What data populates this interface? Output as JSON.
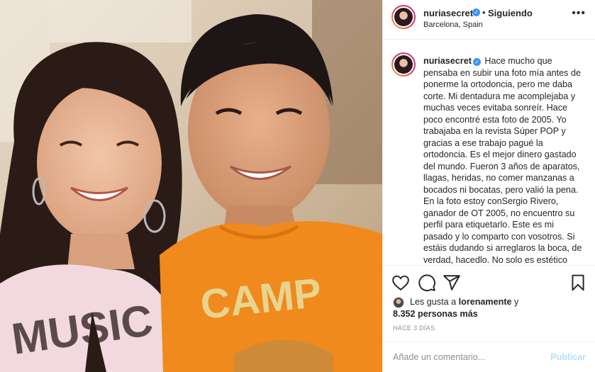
{
  "post": {
    "username": "nuriasecret",
    "follow_state": "Siguiendo",
    "separator": "•",
    "location": "Barcelona, Spain",
    "more_glyph": "•••",
    "verified_glyph": "✓"
  },
  "photo": {
    "shirt_left_text": "MUSIC",
    "shirt_right_text": "CAMP"
  },
  "caption": {
    "username": "nuriasecret",
    "text": "Hace mucho que pensaba en subir una foto mía antes de ponerme la ortodoncia, pero me daba corte. Mi dentadura me acomplejaba y muchas veces evitaba sonreír. Hace poco encontré esta foto de 2005. Yo trabajaba en la revista Súper POP y gracias a ese trabajo pagué la ortodoncia. Es el mejor dinero gastado del mundo. Fueron 3 años de aparatos, llagas, heridas, no comer manzanas a bocados ni bocatas, pero valió la pena. En la foto estoy conSergio Rivero, ganador de OT 2005, no encuentro su perfil para etiquetarlo. Este es mi pasado y lo comparto con vosotros. Si estáis dudando si arreglaros la boca, de verdad, hacedlo. No solo es estético"
  },
  "actions": {
    "like_icon": "heart-icon",
    "comment_icon": "comment-icon",
    "share_icon": "paper-plane-icon",
    "save_icon": "bookmark-icon"
  },
  "likes": {
    "prefix": "Les gusta a ",
    "user": "lorenamente",
    "suffix": " y",
    "count_text": "8.352 personas más"
  },
  "timestamp": "HACE 3 DÍAS",
  "comment": {
    "placeholder": "Añade un comentario...",
    "publish_label": "Publicar"
  },
  "colors": {
    "accent": "#3897f0",
    "publish_disabled": "#b2dffc",
    "border": "#efefef",
    "muted": "#8e8e8e",
    "shirt_orange": "#f08a1c"
  }
}
